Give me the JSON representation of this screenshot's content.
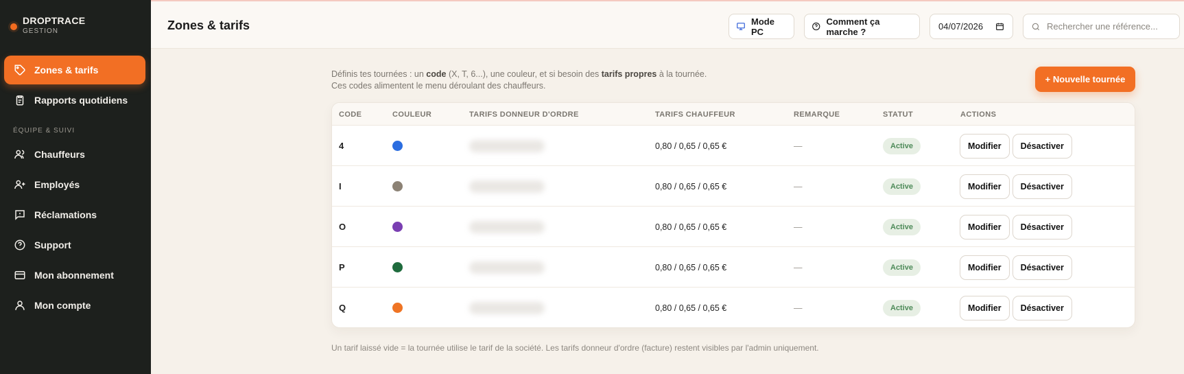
{
  "brand": {
    "name": "DROPTRACE",
    "sub": "GESTION"
  },
  "sidebar": {
    "items": [
      {
        "label": "Zones & tarifs",
        "icon": "tag-icon",
        "active": true
      },
      {
        "label": "Rapports quotidiens",
        "icon": "clipboard-icon"
      },
      {
        "label": "Chauffeurs",
        "icon": "users-icon"
      },
      {
        "label": "Employés",
        "icon": "user-plus-icon"
      },
      {
        "label": "Réclamations",
        "icon": "message-icon"
      },
      {
        "label": "Support",
        "icon": "help-circle-icon"
      },
      {
        "label": "Mon abonnement",
        "icon": "credit-card-icon"
      },
      {
        "label": "Mon compte",
        "icon": "user-icon"
      }
    ],
    "section_label": "ÉQUIPE & SUIVI"
  },
  "header": {
    "title": "Zones & tarifs",
    "mode_pc": "Mode PC",
    "help": "Comment ça marche ?",
    "date": "04/07/2026",
    "search_placeholder": "Rechercher une référence..."
  },
  "intro": {
    "line1_a": "Définis tes tournées : un ",
    "line1_b": "code",
    "line1_c": " (X, T, 6...), une couleur, et si besoin des ",
    "line1_d": "tarifs propres",
    "line1_e": " à la tournée.",
    "line2": "Ces codes alimentent le menu déroulant des chauffeurs."
  },
  "new_button": "+ Nouvelle tournée",
  "table": {
    "headers": [
      "CODE",
      "COULEUR",
      "TARIFS DONNEUR D'ORDRE",
      "TARIFS CHAUFFEUR",
      "REMARQUE",
      "STATUT",
      "ACTIONS"
    ],
    "rows": [
      {
        "code": "4",
        "color": "#2b6de0",
        "tarifs_chauffeur": "0,80 / 0,65 / 0,65 €",
        "remarque": "—",
        "statut": "Active"
      },
      {
        "code": "I",
        "color": "#8c8275",
        "tarifs_chauffeur": "0,80 / 0,65 / 0,65 €",
        "remarque": "—",
        "statut": "Active"
      },
      {
        "code": "O",
        "color": "#7a3fb2",
        "tarifs_chauffeur": "0,80 / 0,65 / 0,65 €",
        "remarque": "—",
        "statut": "Active"
      },
      {
        "code": "P",
        "color": "#1f6b3d",
        "tarifs_chauffeur": "0,80 / 0,65 / 0,65 €",
        "remarque": "—",
        "statut": "Active"
      },
      {
        "code": "Q",
        "color": "#ef7424",
        "tarifs_chauffeur": "0,80 / 0,65 / 0,65 €",
        "remarque": "—",
        "statut": "Active"
      }
    ],
    "edit_label": "Modifier",
    "deactivate_label": "Désactiver"
  },
  "footer_note": "Un tarif laissé vide = la tournée utilise le tarif de la société. Les tarifs donneur d'ordre (facture) restent visibles par l'admin uniquement."
}
